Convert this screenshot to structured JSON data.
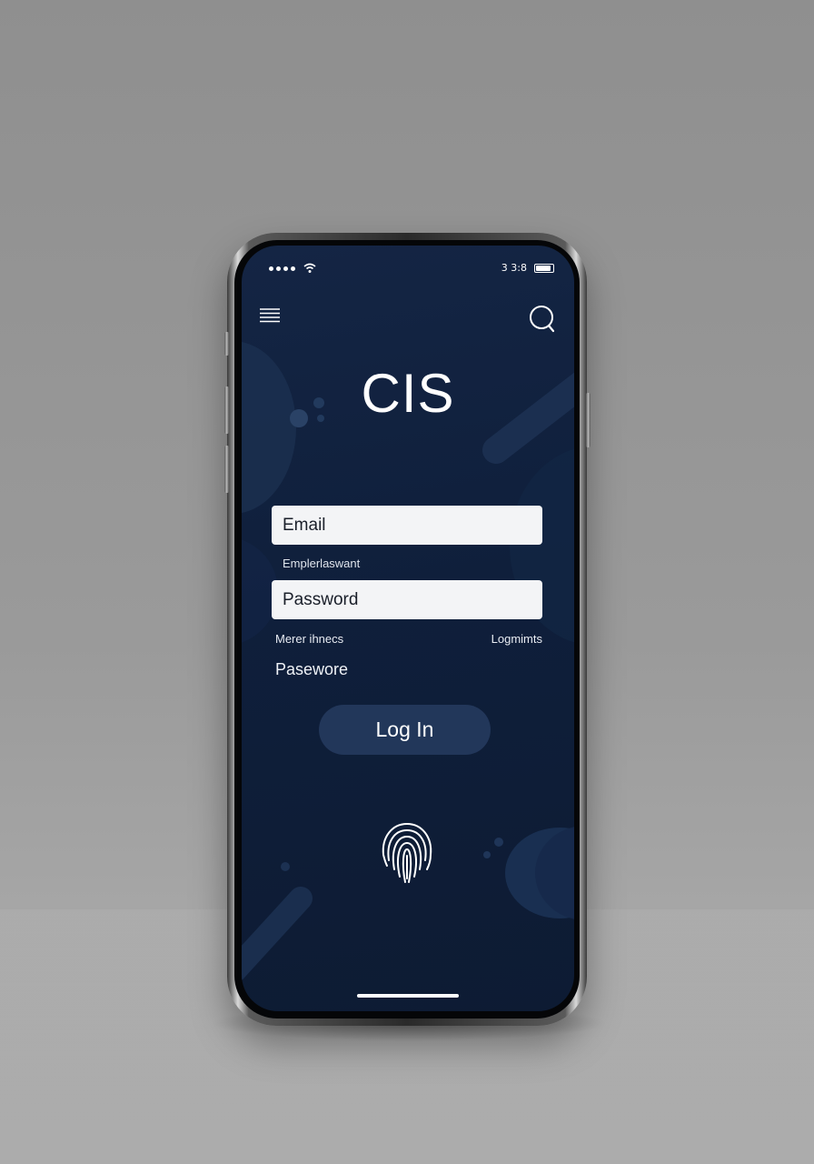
{
  "status_bar": {
    "time": "3 3:8"
  },
  "app": {
    "brand_title": "CIS"
  },
  "login_form": {
    "email_placeholder": "Email",
    "email_helper": "Emplerlaswant",
    "password_placeholder": "Password",
    "remember_link": "Merer ihnecs",
    "login_limits_link": "Logmimts",
    "password_label": "Paseworе",
    "login_button": "Log In"
  },
  "icons": {
    "menu": "hamburger-menu-icon",
    "search": "search-icon",
    "fingerprint": "fingerprint-icon",
    "wifi": "wifi-icon",
    "battery": "battery-icon"
  },
  "colors": {
    "screen_background": "#0f1f3b",
    "input_background": "#f3f4f6",
    "button_background": "#22375a",
    "text": "#ffffff"
  }
}
